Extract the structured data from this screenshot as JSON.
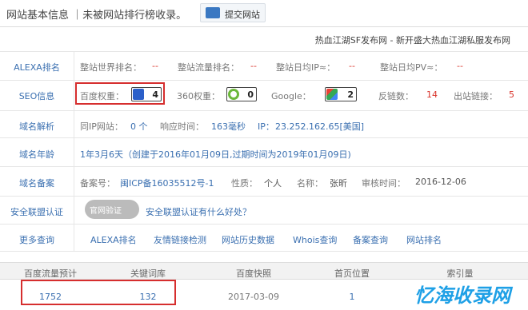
{
  "top": {
    "title": "网站基本信息 ｜未被网站排行榜收录。",
    "submit_label": "提交网站"
  },
  "site_title": "热血江湖SF发布网 - 新开盛大热血江湖私服发布网",
  "rows": {
    "alexa": {
      "label": "ALEXA排名",
      "world_rank_label": "整站世界排名：",
      "world_rank_value": "--",
      "traffic_rank_label": "整站流量排名：",
      "traffic_rank_value": "--",
      "daily_ip_label": "整站日均IP≈：",
      "daily_ip_value": "--",
      "daily_pv_label": "整站日均PV≈：",
      "daily_pv_value": "--"
    },
    "seo": {
      "label": "SEO信息",
      "baidu_label": "百度权重：",
      "baidu_value": "4",
      "s360_label": "360权重：",
      "s360_value": "0",
      "google_label": "Google：",
      "google_value": "2",
      "backlinks_label": "反链数：",
      "backlinks_value": "14",
      "outlinks_label": "出站链接：",
      "outlinks_value": "5"
    },
    "dns": {
      "label": "域名解析",
      "same_ip_label": "同IP网站：",
      "same_ip_value": "0 个",
      "response_label": "响应时间：",
      "response_value": "163毫秒",
      "ip_label": "IP：",
      "ip_value": "23.252.162.65[美国]"
    },
    "age": {
      "label": "域名年龄",
      "value": "1年3月6天（创建于2016年01月09日,过期时间为2019年01月09日)"
    },
    "icp": {
      "label": "域名备案",
      "no_label": "备案号：",
      "no_value": "闽ICP备16035512号-1",
      "type_label": "性质：",
      "type_value": "个人",
      "name_label": "名称：",
      "name_value": "张昕",
      "date_label": "审核时间：",
      "date_value": "2016-12-06"
    },
    "security": {
      "label": "安全联盟认证",
      "badge_text": "官网验证",
      "link": "安全联盟认证有什么好处？"
    },
    "more": {
      "label": "更多查询",
      "links": [
        "ALEXA排名",
        "友情链接检测",
        "网站历史数据",
        "Whois查询",
        "备案查询",
        "网站排名"
      ]
    }
  },
  "bottom": {
    "headers": [
      "百度流量预计",
      "关键词库",
      "百度快照",
      "首页位置",
      "索引量"
    ],
    "values": [
      "1752",
      "132",
      "2017-03-09",
      "1",
      ""
    ]
  },
  "watermark": "忆海收录网",
  "colors": {
    "link_blue": "#3a6fb0",
    "accent_red": "#d9342b",
    "highlight_box": "#d62e2e",
    "watermark": "#1ea0e6"
  }
}
